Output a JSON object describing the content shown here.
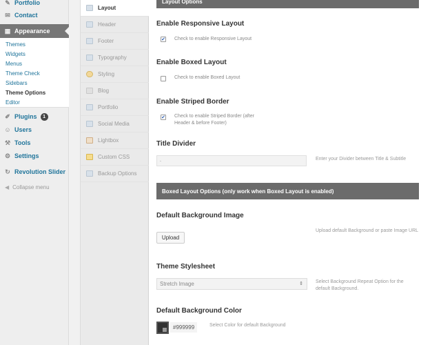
{
  "wp_menu": {
    "items": [
      {
        "label": "Portfolio",
        "icon": "portfolio-icon"
      },
      {
        "label": "Contact",
        "icon": "contact-icon"
      },
      {
        "label": "Appearance",
        "icon": "appearance-icon"
      },
      {
        "label": "Plugins",
        "icon": "plugins-icon",
        "count": "1"
      },
      {
        "label": "Users",
        "icon": "users-icon"
      },
      {
        "label": "Tools",
        "icon": "tools-icon"
      },
      {
        "label": "Settings",
        "icon": "settings-icon"
      },
      {
        "label": "Revolution Slider",
        "icon": "slider-icon"
      }
    ],
    "appearance_sub": [
      "Themes",
      "Widgets",
      "Menus",
      "Theme Check",
      "Sidebars",
      "Theme Options",
      "Editor"
    ],
    "collapse_label": "Collapse menu"
  },
  "options_nav": [
    {
      "label": "Layout",
      "icon": "layout-icon"
    },
    {
      "label": "Header",
      "icon": "header-icon"
    },
    {
      "label": "Footer",
      "icon": "footer-icon"
    },
    {
      "label": "Typography",
      "icon": "typography-icon"
    },
    {
      "label": "Styling",
      "icon": "styling-icon"
    },
    {
      "label": "Blog",
      "icon": "blog-icon"
    },
    {
      "label": "Portfolio",
      "icon": "portfolio-icon"
    },
    {
      "label": "Social Media",
      "icon": "social-icon"
    },
    {
      "label": "Lightbox",
      "icon": "lightbox-icon"
    },
    {
      "label": "Custom CSS",
      "icon": "css-icon"
    },
    {
      "label": "Backup Options",
      "icon": "backup-icon"
    }
  ],
  "content": {
    "layout_bar": "Layout Options",
    "responsive": {
      "title": "Enable Responsive Layout",
      "label": "Check to enable Responsive Layout",
      "checked": true
    },
    "boxed": {
      "title": "Enable Boxed Layout",
      "label": "Check to enable Boxed Layout",
      "checked": false
    },
    "striped": {
      "title": "Enable Striped Border",
      "label": "Check to enable Striped Border (after Header & before Footer)",
      "checked": true
    },
    "divider": {
      "title": "Title Divider",
      "value": ".",
      "desc": "Enter your Divider between Title & Subtitle"
    },
    "boxed_bar": "Boxed Layout Options (only work when Boxed Layout is enabled)",
    "bg_image": {
      "title": "Default Background Image",
      "button": "Upload",
      "desc": "Upload default Background or paste Image URL"
    },
    "stylesheet": {
      "title": "Theme Stylesheet",
      "value": "Stretch Image",
      "desc": "Select Background Repeat Option for the default Background."
    },
    "bg_color": {
      "title": "Default Background Color",
      "hex": "#999999",
      "desc": "Select Color for default Background"
    }
  },
  "colors": {
    "accent": "#21759b",
    "bar": "#6b6b6b"
  }
}
